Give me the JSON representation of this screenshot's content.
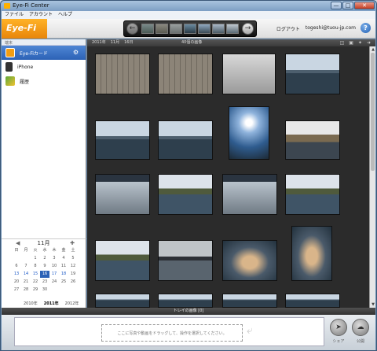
{
  "window": {
    "title": "Eye-Fi Center",
    "controls": [
      "—",
      "□",
      "✕"
    ]
  },
  "menu": [
    "ファイル",
    "アカウント",
    "ヘルプ"
  ],
  "header": {
    "logo": "Eye-Fi",
    "logout": "ログアウト",
    "email": "togeshi@tuou-jp.com",
    "help": "?"
  },
  "sidebar": {
    "section_label": "端末",
    "items": [
      {
        "label": "Eye-Fiカード",
        "selected": true,
        "icon_color": "#f29d12"
      },
      {
        "label": "iPhone",
        "selected": false,
        "icon_color": "#333333"
      },
      {
        "label": "履歴",
        "selected": false,
        "icon_color": "#5aa83a"
      }
    ]
  },
  "calendar": {
    "month": "11月",
    "weekdays": [
      "日",
      "月",
      "火",
      "水",
      "木",
      "金",
      "土"
    ],
    "days": [
      "",
      "",
      "1",
      "2",
      "3",
      "4",
      "5",
      "6",
      "7",
      "8",
      "9",
      "10",
      "11",
      "12",
      "13",
      "14",
      "15",
      "16",
      "17",
      "18",
      "19",
      "20",
      "21",
      "22",
      "23",
      "24",
      "25",
      "26",
      "27",
      "28",
      "29",
      "30",
      "",
      "",
      ""
    ],
    "photo_days": [
      "13",
      "14",
      "15",
      "16",
      "17",
      "18"
    ],
    "selected_day": "16",
    "years": [
      "2010年",
      "2011年",
      "2012年"
    ],
    "current_year": "2011年"
  },
  "toolbar": {
    "year": "2011年",
    "month": "11月",
    "day": "16日",
    "count": "40個の画像"
  },
  "tray": {
    "label": "トレイの画像 [0]",
    "drop_hint": "ここに写真や動画をドラッグして、操作を選択してください。",
    "share_label": "シェア",
    "save_label": "公開"
  },
  "photos": [
    {
      "kind": "board"
    },
    {
      "kind": "board"
    },
    {
      "kind": "screen"
    },
    {
      "kind": "lake"
    },
    {
      "kind": "lake"
    },
    {
      "kind": "lake"
    },
    {
      "kind": "sun"
    },
    {
      "kind": "shore"
    },
    {
      "kind": "water"
    },
    {
      "kind": "mountain"
    },
    {
      "kind": "water"
    },
    {
      "kind": "mountain"
    },
    {
      "kind": "mountain"
    },
    {
      "kind": "cloudy"
    },
    {
      "kind": "fish"
    },
    {
      "kind": "fish"
    },
    {
      "kind": "lake"
    },
    {
      "kind": "lake"
    },
    {
      "kind": "lake"
    },
    {
      "kind": "lake"
    }
  ]
}
